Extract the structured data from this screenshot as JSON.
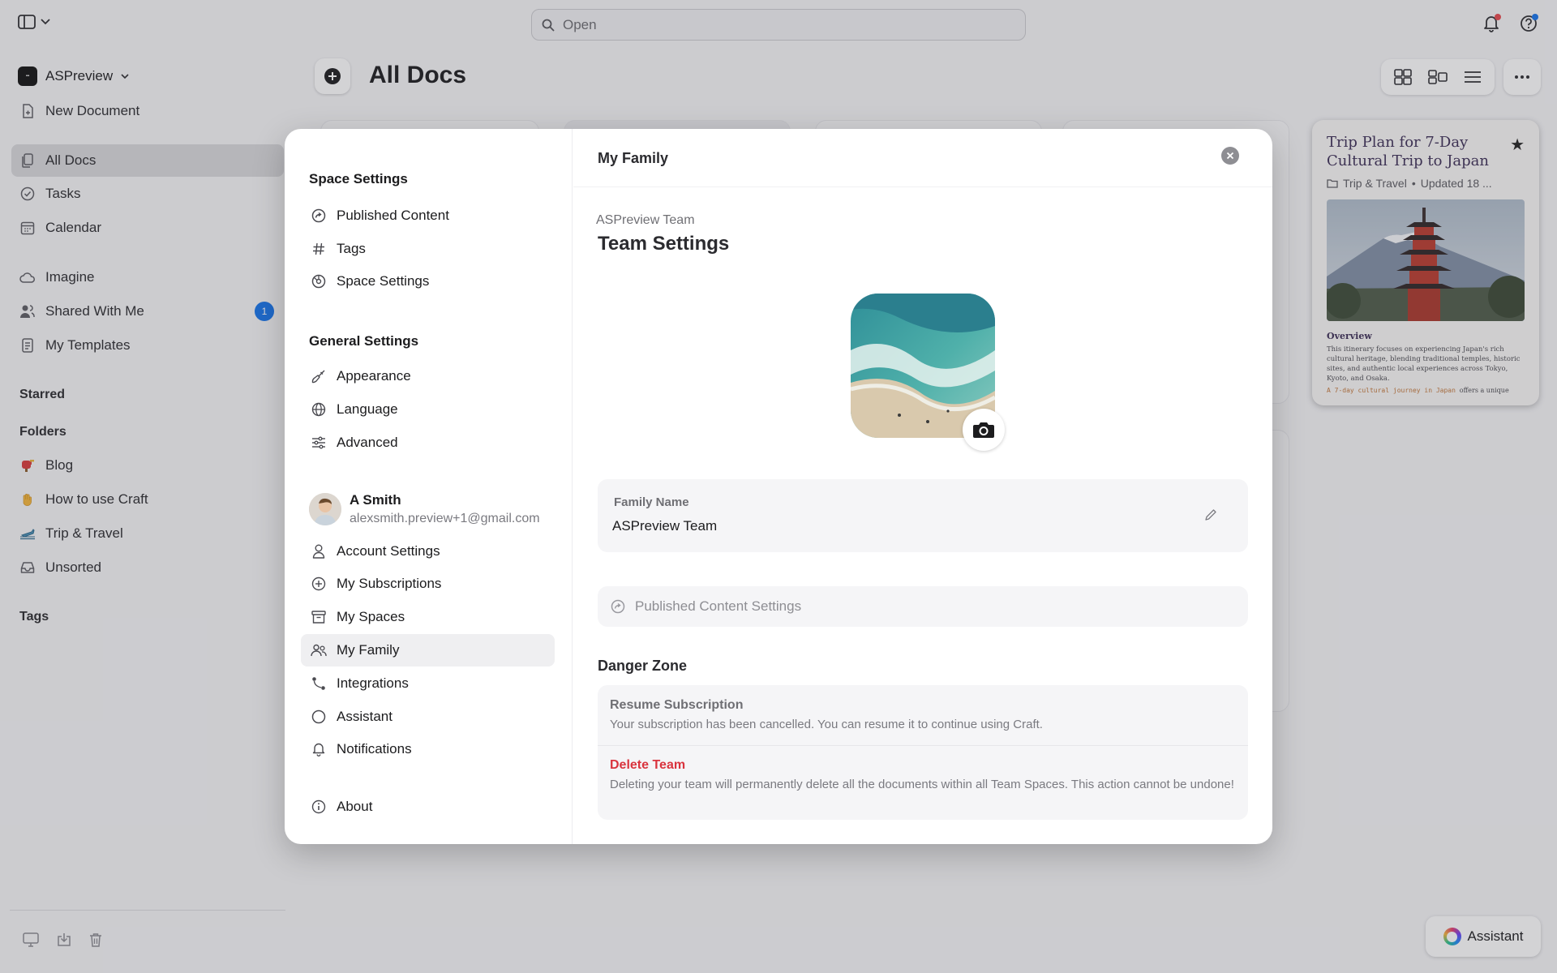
{
  "search": {
    "placeholder": "Open"
  },
  "colors": {
    "accent": "#1572e8",
    "danger": "#d9343e",
    "notif_dot": "#e5484d"
  },
  "sidebar": {
    "workspace": "ASPreview",
    "new_document": "New Document",
    "items": [
      {
        "label": "All Docs",
        "icon": "docs-icon",
        "active": true
      },
      {
        "label": "Tasks",
        "icon": "check-circle-icon"
      },
      {
        "label": "Calendar",
        "icon": "calendar-icon"
      },
      {
        "label": "Imagine",
        "icon": "cloud-icon"
      },
      {
        "label": "Shared With Me",
        "icon": "people-icon",
        "badge": "1"
      },
      {
        "label": "My Templates",
        "icon": "template-icon"
      }
    ],
    "starred_heading": "Starred",
    "folders_heading": "Folders",
    "folders": [
      {
        "label": "Blog",
        "icon": "mailbox-emoji-icon"
      },
      {
        "label": "How to use Craft",
        "icon": "wave-hand-emoji-icon"
      },
      {
        "label": "Trip & Travel",
        "icon": "airplane-emoji-icon"
      },
      {
        "label": "Unsorted",
        "icon": "inbox-icon"
      }
    ],
    "tags_heading": "Tags"
  },
  "main": {
    "title": "All Docs"
  },
  "trip_card": {
    "title": "Trip Plan for 7-Day Cultural Trip to Japan",
    "folder": "Trip & Travel",
    "updated": "Updated 18 ...",
    "overview_heading": "Overview",
    "overview_text": "This itinerary focuses on experiencing Japan's rich cultural heritage, blending traditional temples, historic sites, and authentic local experiences across Tokyo, Kyoto, and Osaka.",
    "highlight": "A 7-day cultural journey in Japan",
    "highlight_tail": "offers a unique"
  },
  "assistant": {
    "label": "Assistant"
  },
  "modal": {
    "title": "My Family",
    "nav": {
      "space_heading": "Space Settings",
      "space_items": [
        {
          "label": "Published Content",
          "icon": "share-arrow-icon"
        },
        {
          "label": "Tags",
          "icon": "hash-icon"
        },
        {
          "label": "Space Settings",
          "icon": "space-gear-icon"
        }
      ],
      "general_heading": "General Settings",
      "general_items": [
        {
          "label": "Appearance",
          "icon": "brush-icon"
        },
        {
          "label": "Language",
          "icon": "globe-icon"
        },
        {
          "label": "Advanced",
          "icon": "sliders-icon"
        }
      ],
      "user": {
        "name": "A Smith",
        "email": "alexsmith.preview+1@gmail.com"
      },
      "account_items": [
        {
          "label": "Account Settings",
          "icon": "person-icon"
        },
        {
          "label": "My Subscriptions",
          "icon": "plus-circle-icon"
        },
        {
          "label": "My Spaces",
          "icon": "archive-box-icon"
        },
        {
          "label": "My Family",
          "icon": "family-icon",
          "active": true
        },
        {
          "label": "Integrations",
          "icon": "integration-icon"
        },
        {
          "label": "Assistant",
          "icon": "circle-icon"
        },
        {
          "label": "Notifications",
          "icon": "bell-icon"
        }
      ],
      "about": "About"
    },
    "team_label": "ASPreview Team",
    "heading": "Team Settings",
    "field": {
      "label": "Family Name",
      "value": "ASPreview Team"
    },
    "published_settings": "Published Content Settings",
    "danger": {
      "heading": "Danger Zone",
      "resume_title": "Resume Subscription",
      "resume_desc": "Your subscription has been cancelled. You can resume it to continue using Craft.",
      "delete_title": "Delete Team",
      "delete_desc": "Deleting your team will permanently delete all the documents within all Team Spaces. This action cannot be undone!"
    }
  }
}
